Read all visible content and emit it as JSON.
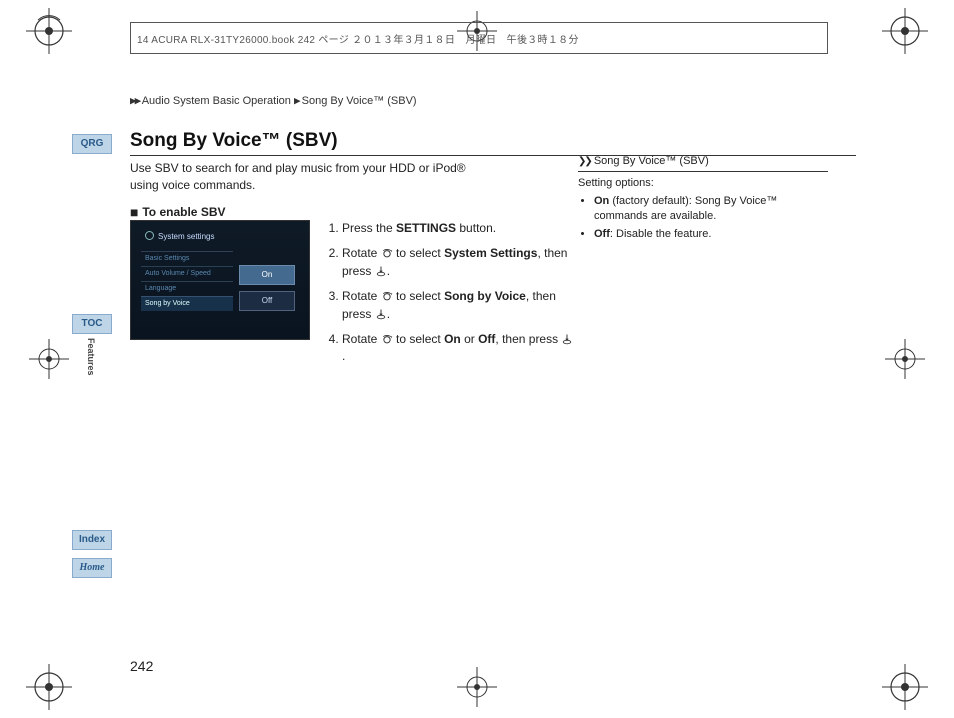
{
  "doc_header": "14 ACURA RLX-31TY26000.book  242 ページ  ２０１３年３月１８日　月曜日　午後３時１８分",
  "breadcrumb": {
    "a": "Audio System Basic Operation",
    "b": "Song By Voice™ (SBV)"
  },
  "nav": {
    "qrg": "QRG",
    "toc": "TOC",
    "index": "Index",
    "home": "Home",
    "section": "Features"
  },
  "title": "Song By Voice™ (SBV)",
  "intro": "Use SBV to search for and play music from your HDD or iPod® using voice commands.",
  "subhead": "To enable SBV",
  "screenshot": {
    "header": "System settings",
    "menu": [
      "Basic Settings",
      "Auto Volume / Speed",
      "Language",
      "Song by Voice"
    ],
    "menu_active_index": 3,
    "options": [
      "On",
      "Off"
    ],
    "option_hl_index": 0
  },
  "steps": [
    {
      "pre": "Press the ",
      "bold": "SETTINGS",
      "post": " button."
    },
    {
      "pre": "Rotate ",
      "dial": true,
      "mid": " to select ",
      "bold": "System Settings",
      "post2": ", then press ",
      "push": true,
      "end": "."
    },
    {
      "pre": "Rotate ",
      "dial": true,
      "mid": " to select ",
      "bold": "Song by Voice",
      "post2": ", then press ",
      "push": true,
      "end": "."
    },
    {
      "pre": "Rotate ",
      "dial": true,
      "mid": " to select ",
      "bold": "On",
      "mid2": " or ",
      "bold2": "Off",
      "post2": ", then press ",
      "push": true,
      "end": "."
    }
  ],
  "sideinfo": {
    "header": "Song By Voice™ (SBV)",
    "setting_label": "Setting options:",
    "opts": [
      {
        "label": "On",
        "desc": " (factory default): Song By Voice™ commands are available."
      },
      {
        "label": "Off",
        "desc": ": Disable the feature."
      }
    ]
  },
  "page_number": "242"
}
